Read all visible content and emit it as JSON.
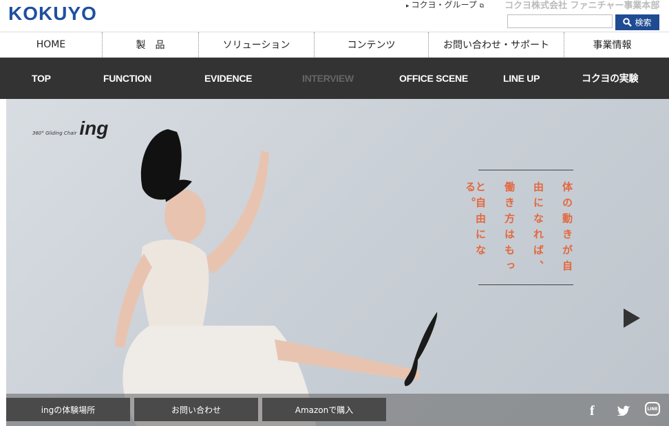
{
  "header": {
    "logo": "KOKUYO",
    "group_link": "コクヨ・グループ",
    "company": "コクヨ株式会社 ファニチャー事業本部",
    "search_placeholder": "",
    "search_button": "検索"
  },
  "global_nav": [
    "HOME",
    "製　品",
    "ソリューション",
    "コンテンツ",
    "お問い合わせ・サポート",
    "事業情報"
  ],
  "sub_nav": [
    "TOP",
    "FUNCTION",
    "EVIDENCE",
    "INTERVIEW",
    "OFFICE SCENE",
    "LINE UP",
    "コクヨの実験"
  ],
  "hero": {
    "brand_small": "360° Gliding Chair",
    "brand_big": "ing",
    "copy_lines": [
      "体の動きが自",
      "由になれば、",
      "働き方はもっ",
      "と自由になる。"
    ],
    "accent_color": "#e2683f"
  },
  "bottom_buttons": [
    "ingの体験場所",
    "お問い合わせ",
    "Amazonで購入"
  ],
  "social_icons": [
    "facebook-icon",
    "twitter-icon",
    "line-icon"
  ],
  "colors": {
    "brand_blue": "#1f4fa0",
    "subnav_bg": "#333333"
  }
}
